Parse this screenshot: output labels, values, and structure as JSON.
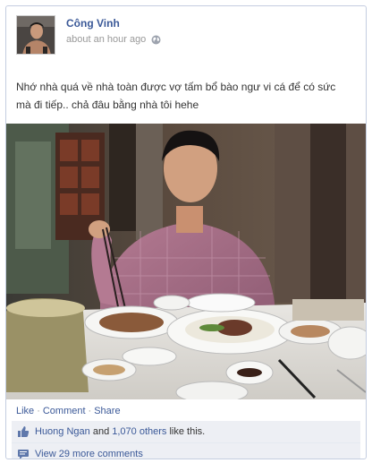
{
  "post": {
    "author": "Công Vinh",
    "timestamp": "about an hour ago",
    "privacy_icon": "globe-icon",
    "message": "Nhớ nhà quá về nhà toàn được vợ tấm bổ bào ngư vi cá để có sức mà đi tiếp.. chả đâu bằng nhà tôi hehe"
  },
  "actions": {
    "like": "Like",
    "comment": "Comment",
    "share": "Share",
    "separator": "·"
  },
  "ufi": {
    "likes": {
      "icon": "thumbs-up-icon",
      "name_link": "Huong Ngan",
      "rest": " and ",
      "others_link": "1,070 others",
      "suffix": " like this."
    },
    "comments": {
      "icon": "comment-bubble-icon",
      "label": "View 29 more comments"
    }
  },
  "colors": {
    "link": "#3b5998",
    "muted": "#999999",
    "ufi_bg": "#edeff4",
    "border": "#c4cde0"
  }
}
